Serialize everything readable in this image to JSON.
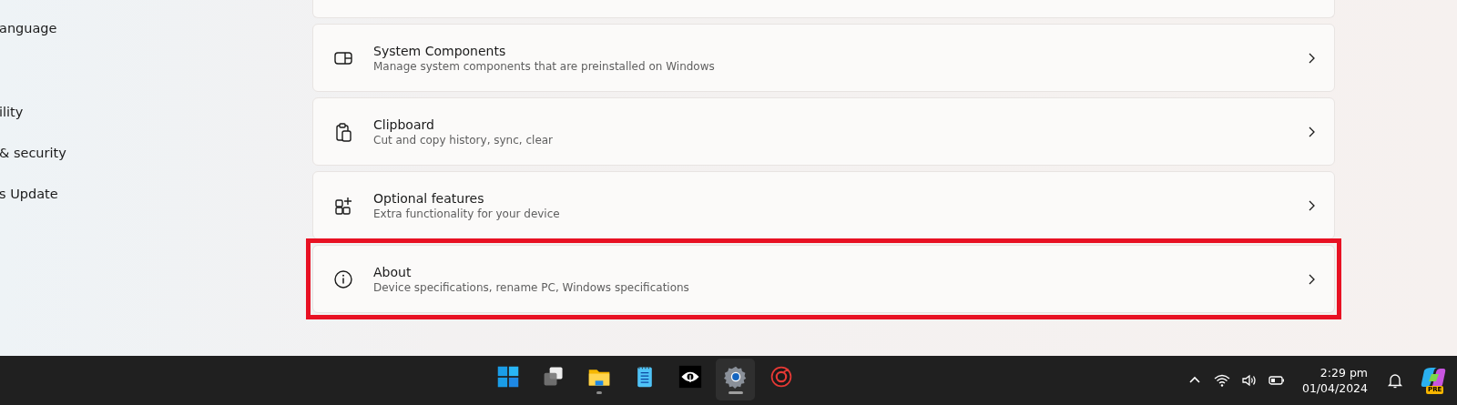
{
  "sidebar": {
    "items": [
      {
        "label": "anguage"
      },
      {
        "label": "ility"
      },
      {
        "label": "& security"
      },
      {
        "label": "s Update"
      }
    ]
  },
  "settings": {
    "items": [
      {
        "title": "System Components",
        "description": "Manage system components that are preinstalled on Windows",
        "highlighted": false
      },
      {
        "title": "Clipboard",
        "description": "Cut and copy history, sync, clear",
        "highlighted": false
      },
      {
        "title": "Optional features",
        "description": "Extra functionality for your device",
        "highlighted": false
      },
      {
        "title": "About",
        "description": "Device specifications, rename PC, Windows specifications",
        "highlighted": true
      }
    ]
  },
  "taskbar": {
    "apps": [
      {
        "running": false,
        "selected": false
      },
      {
        "running": false,
        "selected": false
      },
      {
        "running": true,
        "selected": false
      },
      {
        "running": false,
        "selected": false
      },
      {
        "running": false,
        "selected": false
      },
      {
        "running": true,
        "selected": true
      },
      {
        "running": false,
        "selected": false
      }
    ],
    "time": "2:29 pm",
    "date": "01/04/2024",
    "badge": "PRE"
  }
}
